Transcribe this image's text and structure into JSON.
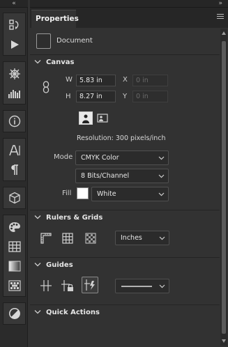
{
  "dock": {
    "collapse_glyph": "«",
    "tools": [
      {
        "icon": "history-icon"
      },
      {
        "icon": "play-actions-icon"
      },
      {
        "icon": "brush-settings-icon"
      },
      {
        "icon": "brushes-icon"
      },
      {
        "icon": "info-icon"
      },
      {
        "icon": "character-icon"
      },
      {
        "icon": "paragraph-icon"
      },
      {
        "icon": "3d-cube-icon"
      },
      {
        "icon": "color-palette-icon"
      },
      {
        "icon": "swatches-icon"
      },
      {
        "icon": "gradients-icon"
      },
      {
        "icon": "patterns-icon"
      },
      {
        "icon": "adjustments-icon"
      }
    ]
  },
  "panel": {
    "collapse_glyph": "»",
    "tab_label": "Properties",
    "document_label": "Document"
  },
  "canvas": {
    "title": "Canvas",
    "w_label": "W",
    "w_value": "5.83 in",
    "h_label": "H",
    "h_value": "8.27 in",
    "x_label": "X",
    "x_value": "0 in",
    "y_label": "Y",
    "y_value": "0 in",
    "resolution": "Resolution: 300 pixels/inch",
    "mode_label": "Mode",
    "mode_value": "CMYK Color",
    "depth_value": "8 Bits/Channel",
    "fill_label": "Fill",
    "fill_value": "White",
    "fill_color": "#ffffff"
  },
  "rulers": {
    "title": "Rulers & Grids",
    "units_value": "Inches"
  },
  "guides": {
    "title": "Guides"
  },
  "quick_actions": {
    "title": "Quick Actions"
  }
}
